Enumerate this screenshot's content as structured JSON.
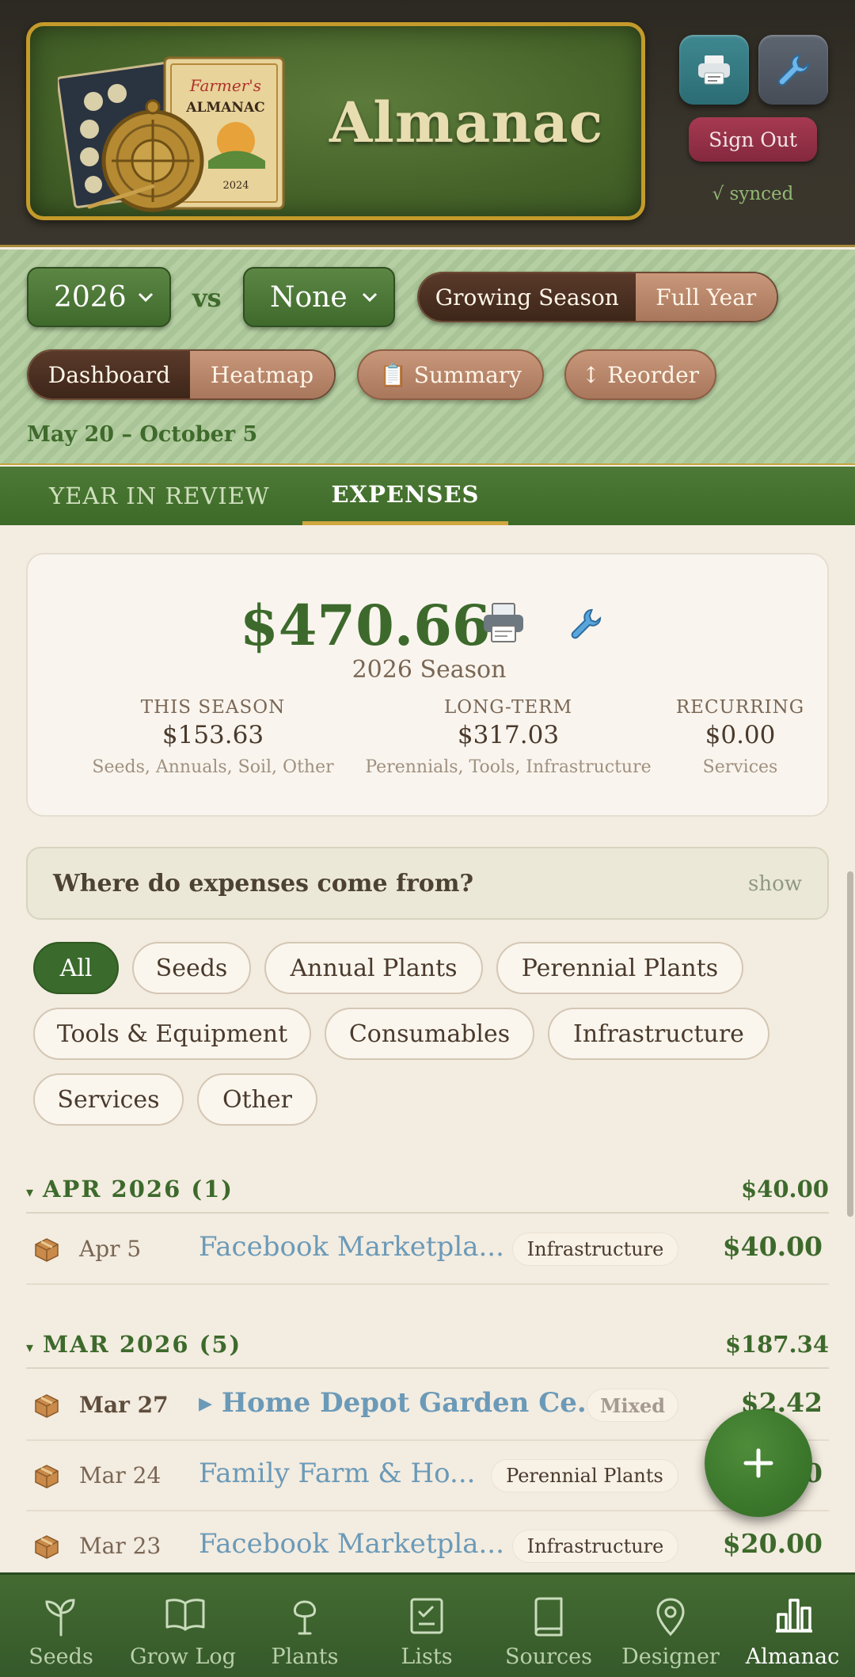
{
  "header": {
    "title": "Almanac",
    "book_title_line1": "Farmer's",
    "book_title_line2": "ALMANAC",
    "book_year": "2024",
    "sign_out": "Sign Out",
    "sync_status": "√ synced"
  },
  "controls": {
    "year_value": "2026",
    "vs_label": "vs",
    "compare_value": "None",
    "season_options": [
      "Growing Season",
      "Full Year"
    ],
    "season_selected": "Growing Season",
    "view_options": [
      "Dashboard",
      "Heatmap"
    ],
    "view_selected": "Dashboard",
    "summary_label": "📋 Summary",
    "reorder_label": "↕ Reorder",
    "date_range": "May 20 – October 5"
  },
  "tabs": [
    {
      "label": "YEAR IN REVIEW",
      "active": false
    },
    {
      "label": "EXPENSES",
      "active": true
    }
  ],
  "summary": {
    "total": "$470.66",
    "season_label": "2026 Season",
    "stats": [
      {
        "heading": "THIS SEASON",
        "value": "$153.63",
        "sub": "Seeds, Annuals, Soil, Other"
      },
      {
        "heading": "LONG-TERM",
        "value": "$317.03",
        "sub": "Perennials, Tools, Infrastructure"
      },
      {
        "heading": "RECURRING",
        "value": "$0.00",
        "sub": "Services"
      }
    ]
  },
  "breakdown": {
    "title": "Where do expenses come from?",
    "toggle": "show"
  },
  "filters": {
    "chips": [
      "All",
      "Seeds",
      "Annual Plants",
      "Perennial Plants",
      "Tools & Equipment",
      "Consumables",
      "Infrastructure",
      "Services",
      "Other"
    ],
    "selected": "All"
  },
  "months": [
    {
      "label": "APR 2026 (1)",
      "total": "$40.00",
      "rows": [
        {
          "date": "Apr 5",
          "vendor": "Facebook Marketpla...",
          "category": "Infrastructure",
          "amount": "$40.00"
        }
      ]
    },
    {
      "label": "MAR 2026 (5)",
      "total": "$187.34",
      "rows": [
        {
          "date": "Mar 27",
          "vendor": "▸ Home Depot Garden Ce...",
          "category": "Mixed",
          "amount": "$2.42"
        },
        {
          "date": "Mar 24",
          "vendor": "Family Farm & Ho...",
          "category": "Perennial Plants",
          "amount": "$0"
        },
        {
          "date": "Mar 23",
          "vendor": "Facebook Marketpla...",
          "category": "Infrastructure",
          "amount": "$20.00"
        }
      ]
    }
  ],
  "nav": [
    {
      "label": "Seeds",
      "icon": "sprout-icon"
    },
    {
      "label": "Grow Log",
      "icon": "book-open-icon"
    },
    {
      "label": "Plants",
      "icon": "plant-icon"
    },
    {
      "label": "Lists",
      "icon": "checklist-icon"
    },
    {
      "label": "Sources",
      "icon": "book-icon"
    },
    {
      "label": "Designer",
      "icon": "map-pin-icon"
    },
    {
      "label": "Almanac",
      "icon": "bar-chart-icon",
      "active": true
    }
  ],
  "colors": {
    "brand_green": "#3d6a2c",
    "gold": "#c49a2a",
    "link_blue": "#6b9ab8",
    "sign_out_red": "#a63a52"
  }
}
